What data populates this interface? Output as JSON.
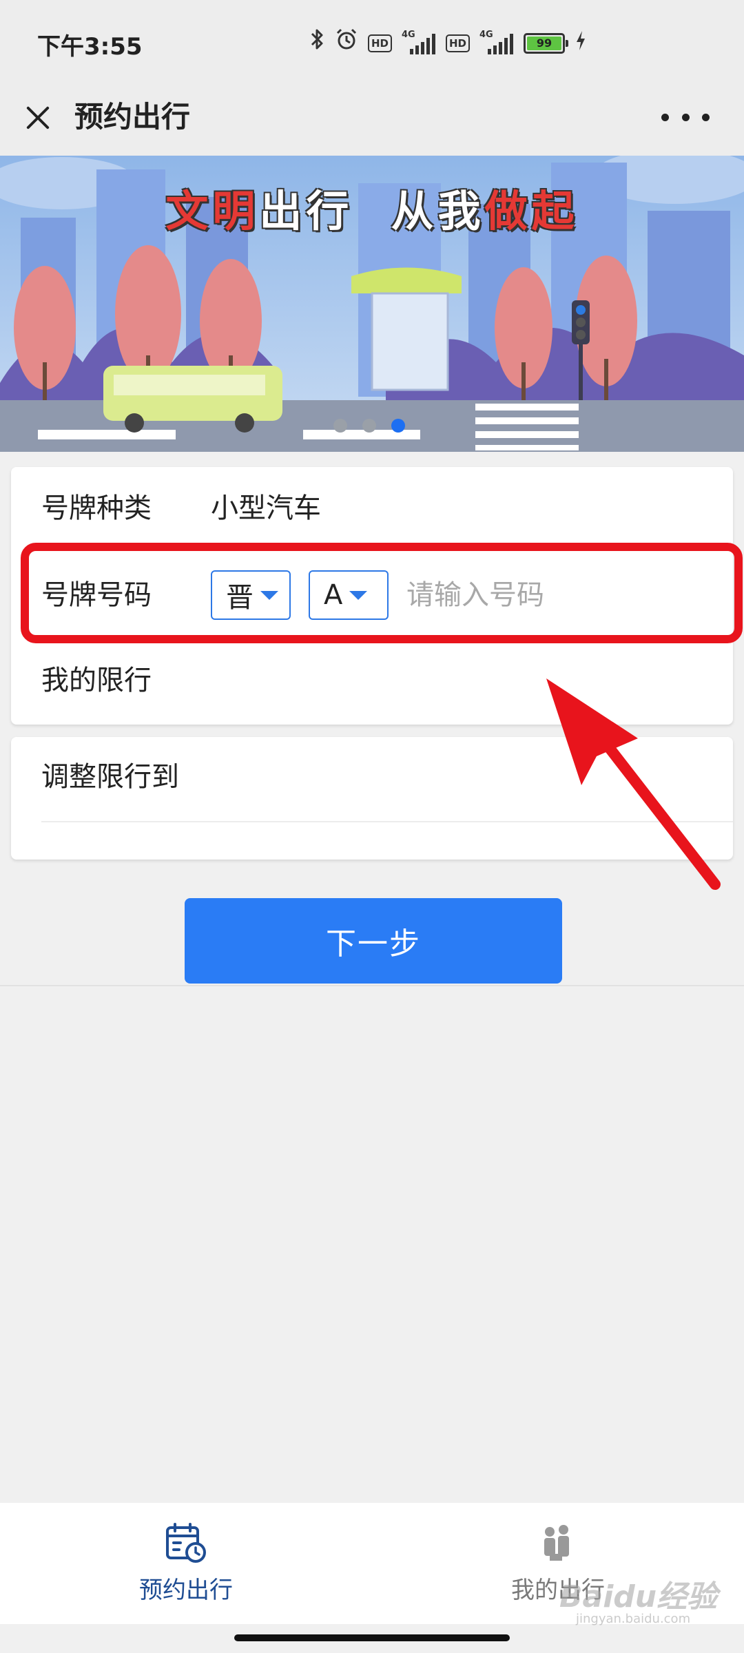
{
  "status_bar": {
    "time": "下午3:55",
    "hd": "HD",
    "network": "4G",
    "battery": "99",
    "icons": [
      "bluetooth-icon",
      "alarm-icon",
      "signal-icon",
      "battery-icon",
      "charging-icon"
    ]
  },
  "title_bar": {
    "title": "预约出行",
    "icons": [
      "close-icon",
      "more-icon"
    ]
  },
  "banner": {
    "slogan_part1": "文明",
    "slogan_part2": "出行",
    "slogan_part3": "从我",
    "slogan_part4": "做起",
    "slide_count": 3,
    "active_slide": 3
  },
  "form": {
    "plate_type": {
      "label": "号牌种类",
      "value": "小型汽车"
    },
    "plate_number": {
      "label": "号牌号码",
      "province": "晋",
      "letter": "A",
      "placeholder": "请输入号码"
    },
    "my_limit": {
      "label": "我的限行"
    },
    "adjust_limit": {
      "label": "调整限行到"
    }
  },
  "next_button": "下一步",
  "tabs": [
    {
      "label": "预约出行",
      "icon": "calendar-clock-icon",
      "active": true
    },
    {
      "label": "我的出行",
      "icon": "people-icon",
      "active": false
    }
  ],
  "watermark": {
    "brand": "Baidu经验",
    "url": "jingyan.baidu.com"
  },
  "colors": {
    "accent": "#2a7cf5",
    "active_tab": "#1f4d93",
    "highlight": "#e8141c",
    "background": "#f0f0f0"
  }
}
